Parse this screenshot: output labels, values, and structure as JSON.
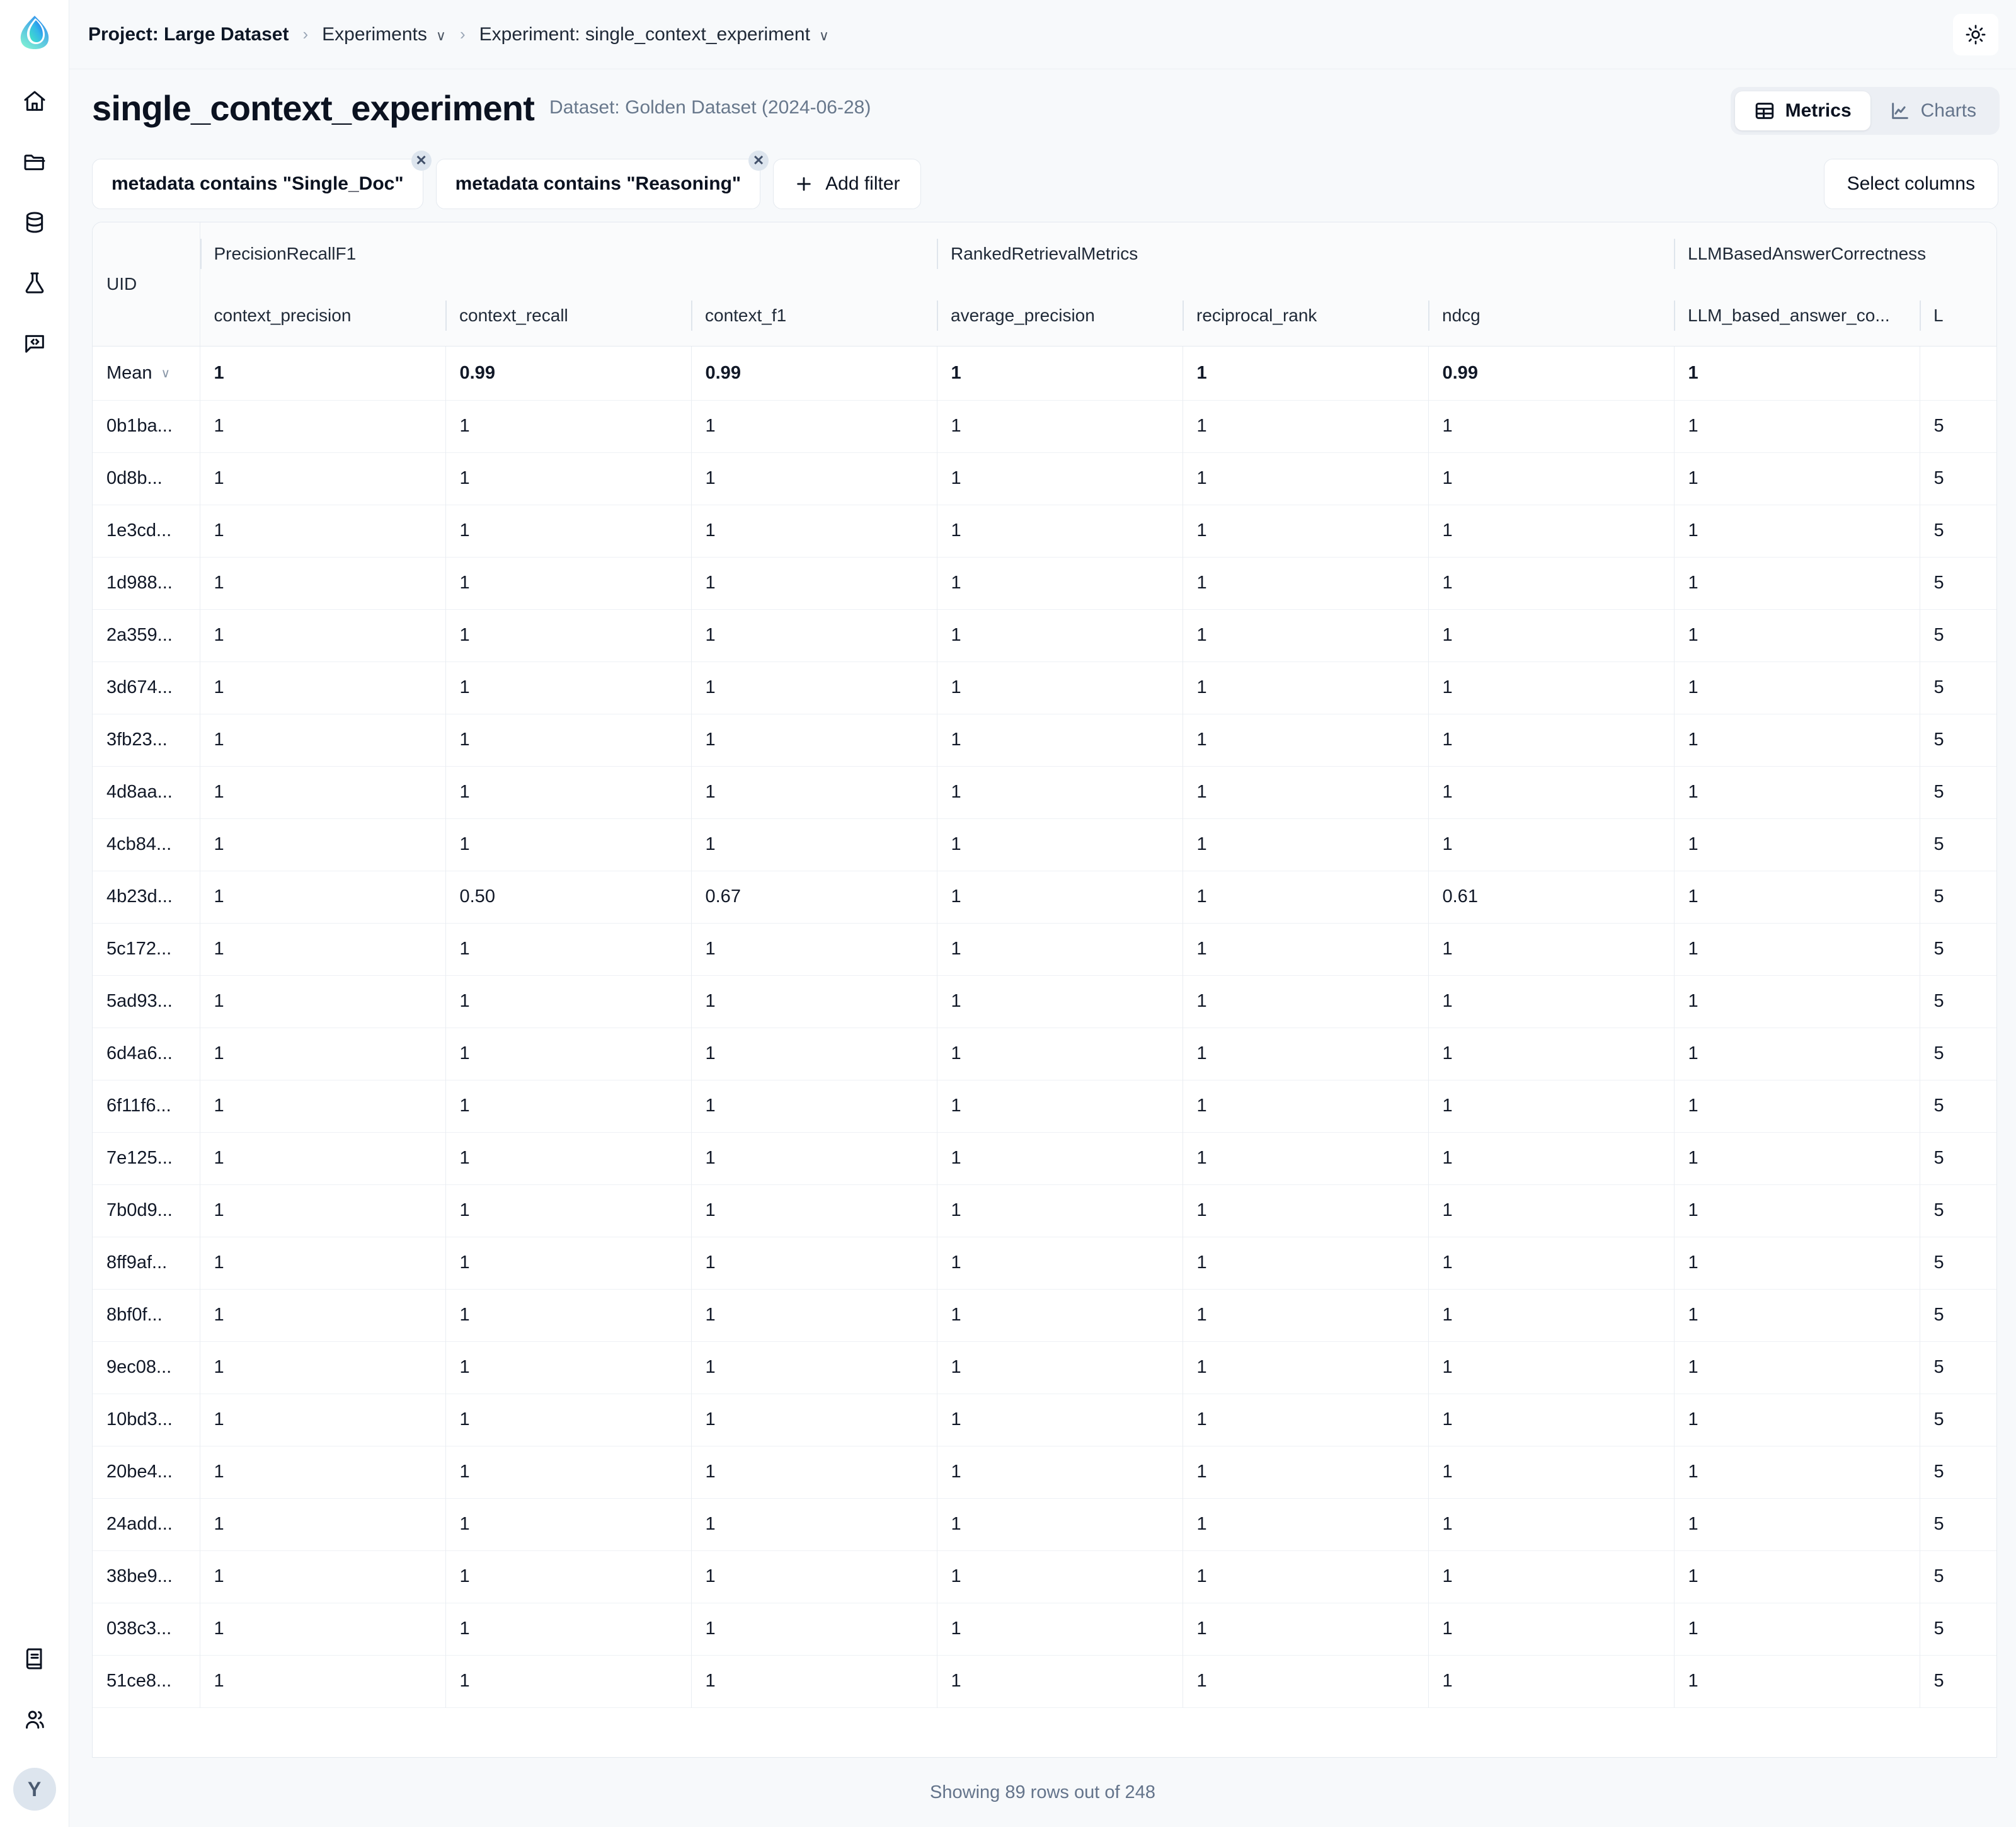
{
  "brand": {
    "logo_icon": "phoenix-logo",
    "accent_from": "#4fe3c1",
    "accent_to": "#1b6ef3"
  },
  "sidebar": {
    "items": [
      {
        "icon": "home-icon",
        "name": "home"
      },
      {
        "icon": "folder-icon",
        "name": "projects"
      },
      {
        "icon": "database-icon",
        "name": "datasets"
      },
      {
        "icon": "flask-icon",
        "name": "experiments"
      },
      {
        "icon": "prompt-code-icon",
        "name": "prompts"
      }
    ],
    "bottom_items": [
      {
        "icon": "book-icon",
        "name": "docs"
      },
      {
        "icon": "users-icon",
        "name": "settings-people"
      }
    ],
    "avatar_initial": "Y"
  },
  "breadcrumb": {
    "project": "Project: Large Dataset",
    "separator": "›",
    "experiments": "Experiments",
    "experiment": "Experiment: single_context_experiment",
    "caret": "∨"
  },
  "header": {
    "title": "single_context_experiment",
    "dataset": "Dataset: Golden Dataset (2024-06-28)",
    "theme_toggle_icon": "sun-icon"
  },
  "view_switch": {
    "metrics_label": "Metrics",
    "metrics_icon": "table-icon",
    "charts_label": "Charts",
    "charts_icon": "line-chart-icon",
    "active": "Metrics"
  },
  "filters": {
    "chips": [
      {
        "label": "metadata contains \"Single_Doc\"",
        "remove_icon": "close-circle-icon",
        "remove_glyph": "✕"
      },
      {
        "label": "metadata contains \"Reasoning\"",
        "remove_icon": "close-circle-icon",
        "remove_glyph": "✕"
      }
    ],
    "add_filter_label": "Add filter",
    "add_filter_icon": "plus-icon",
    "select_columns_label": "Select columns"
  },
  "table": {
    "uid_header": "UID",
    "groups": [
      {
        "label": "PrecisionRecallF1",
        "span": 3
      },
      {
        "label": "RankedRetrievalMetrics",
        "span": 3
      },
      {
        "label": "LLMBasedAnswerCorrectness",
        "span": 2
      }
    ],
    "columns": [
      "context_precision",
      "context_recall",
      "context_f1",
      "average_precision",
      "reciprocal_rank",
      "ndcg",
      "LLM_based_answer_co...",
      "L"
    ],
    "mean_row": {
      "label": "Mean",
      "caret": "∨",
      "values": [
        "1",
        "0.99",
        "0.99",
        "1",
        "1",
        "0.99",
        "1",
        ""
      ]
    },
    "rows": [
      {
        "uid": "0b1ba...",
        "values": [
          "1",
          "1",
          "1",
          "1",
          "1",
          "1",
          "1",
          "5"
        ]
      },
      {
        "uid": "0d8b...",
        "values": [
          "1",
          "1",
          "1",
          "1",
          "1",
          "1",
          "1",
          "5"
        ]
      },
      {
        "uid": "1e3cd...",
        "values": [
          "1",
          "1",
          "1",
          "1",
          "1",
          "1",
          "1",
          "5"
        ]
      },
      {
        "uid": "1d988...",
        "values": [
          "1",
          "1",
          "1",
          "1",
          "1",
          "1",
          "1",
          "5"
        ]
      },
      {
        "uid": "2a359...",
        "values": [
          "1",
          "1",
          "1",
          "1",
          "1",
          "1",
          "1",
          "5"
        ]
      },
      {
        "uid": "3d674...",
        "values": [
          "1",
          "1",
          "1",
          "1",
          "1",
          "1",
          "1",
          "5"
        ]
      },
      {
        "uid": "3fb23...",
        "values": [
          "1",
          "1",
          "1",
          "1",
          "1",
          "1",
          "1",
          "5"
        ]
      },
      {
        "uid": "4d8aa...",
        "values": [
          "1",
          "1",
          "1",
          "1",
          "1",
          "1",
          "1",
          "5"
        ]
      },
      {
        "uid": "4cb84...",
        "values": [
          "1",
          "1",
          "1",
          "1",
          "1",
          "1",
          "1",
          "5"
        ]
      },
      {
        "uid": "4b23d...",
        "values": [
          "1",
          "0.50",
          "0.67",
          "1",
          "1",
          "0.61",
          "1",
          "5"
        ]
      },
      {
        "uid": "5c172...",
        "values": [
          "1",
          "1",
          "1",
          "1",
          "1",
          "1",
          "1",
          "5"
        ]
      },
      {
        "uid": "5ad93...",
        "values": [
          "1",
          "1",
          "1",
          "1",
          "1",
          "1",
          "1",
          "5"
        ]
      },
      {
        "uid": "6d4a6...",
        "values": [
          "1",
          "1",
          "1",
          "1",
          "1",
          "1",
          "1",
          "5"
        ]
      },
      {
        "uid": "6f11f6...",
        "values": [
          "1",
          "1",
          "1",
          "1",
          "1",
          "1",
          "1",
          "5"
        ]
      },
      {
        "uid": "7e125...",
        "values": [
          "1",
          "1",
          "1",
          "1",
          "1",
          "1",
          "1",
          "5"
        ]
      },
      {
        "uid": "7b0d9...",
        "values": [
          "1",
          "1",
          "1",
          "1",
          "1",
          "1",
          "1",
          "5"
        ]
      },
      {
        "uid": "8ff9af...",
        "values": [
          "1",
          "1",
          "1",
          "1",
          "1",
          "1",
          "1",
          "5"
        ]
      },
      {
        "uid": "8bf0f...",
        "values": [
          "1",
          "1",
          "1",
          "1",
          "1",
          "1",
          "1",
          "5"
        ]
      },
      {
        "uid": "9ec08...",
        "values": [
          "1",
          "1",
          "1",
          "1",
          "1",
          "1",
          "1",
          "5"
        ]
      },
      {
        "uid": "10bd3...",
        "values": [
          "1",
          "1",
          "1",
          "1",
          "1",
          "1",
          "1",
          "5"
        ]
      },
      {
        "uid": "20be4...",
        "values": [
          "1",
          "1",
          "1",
          "1",
          "1",
          "1",
          "1",
          "5"
        ]
      },
      {
        "uid": "24add...",
        "values": [
          "1",
          "1",
          "1",
          "1",
          "1",
          "1",
          "1",
          "5"
        ]
      },
      {
        "uid": "38be9...",
        "values": [
          "1",
          "1",
          "1",
          "1",
          "1",
          "1",
          "1",
          "5"
        ]
      },
      {
        "uid": "038c3...",
        "values": [
          "1",
          "1",
          "1",
          "1",
          "1",
          "1",
          "1",
          "5"
        ]
      },
      {
        "uid": "51ce8...",
        "values": [
          "1",
          "1",
          "1",
          "1",
          "1",
          "1",
          "1",
          "5"
        ]
      }
    ]
  },
  "footer": {
    "status": "Showing 89 rows out of 248"
  }
}
